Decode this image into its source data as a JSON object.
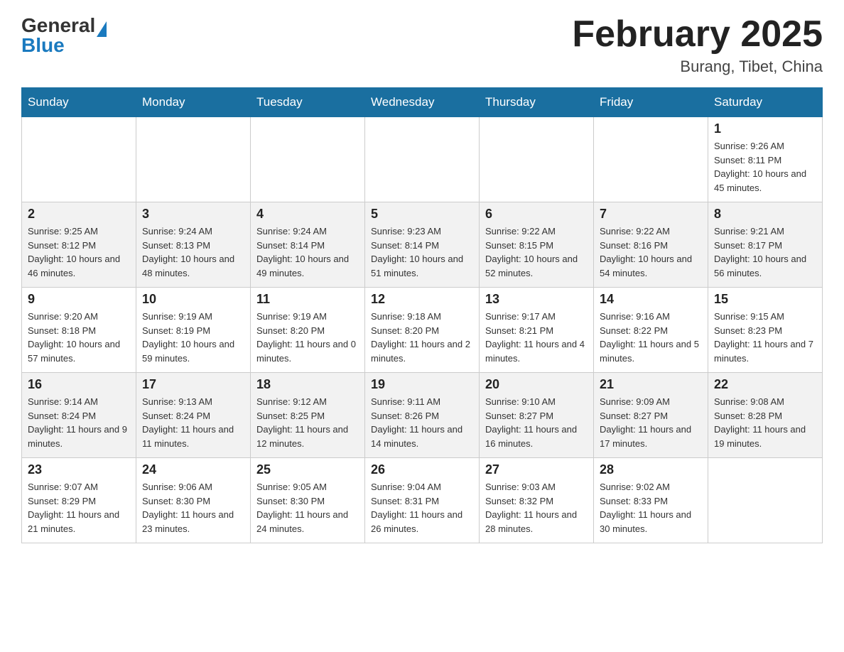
{
  "header": {
    "logo_general": "General",
    "logo_blue": "Blue",
    "month_title": "February 2025",
    "location": "Burang, Tibet, China"
  },
  "days_of_week": [
    "Sunday",
    "Monday",
    "Tuesday",
    "Wednesday",
    "Thursday",
    "Friday",
    "Saturday"
  ],
  "weeks": [
    [
      {
        "day": "",
        "sunrise": "",
        "sunset": "",
        "daylight": ""
      },
      {
        "day": "",
        "sunrise": "",
        "sunset": "",
        "daylight": ""
      },
      {
        "day": "",
        "sunrise": "",
        "sunset": "",
        "daylight": ""
      },
      {
        "day": "",
        "sunrise": "",
        "sunset": "",
        "daylight": ""
      },
      {
        "day": "",
        "sunrise": "",
        "sunset": "",
        "daylight": ""
      },
      {
        "day": "",
        "sunrise": "",
        "sunset": "",
        "daylight": ""
      },
      {
        "day": "1",
        "sunrise": "Sunrise: 9:26 AM",
        "sunset": "Sunset: 8:11 PM",
        "daylight": "Daylight: 10 hours and 45 minutes."
      }
    ],
    [
      {
        "day": "2",
        "sunrise": "Sunrise: 9:25 AM",
        "sunset": "Sunset: 8:12 PM",
        "daylight": "Daylight: 10 hours and 46 minutes."
      },
      {
        "day": "3",
        "sunrise": "Sunrise: 9:24 AM",
        "sunset": "Sunset: 8:13 PM",
        "daylight": "Daylight: 10 hours and 48 minutes."
      },
      {
        "day": "4",
        "sunrise": "Sunrise: 9:24 AM",
        "sunset": "Sunset: 8:14 PM",
        "daylight": "Daylight: 10 hours and 49 minutes."
      },
      {
        "day": "5",
        "sunrise": "Sunrise: 9:23 AM",
        "sunset": "Sunset: 8:14 PM",
        "daylight": "Daylight: 10 hours and 51 minutes."
      },
      {
        "day": "6",
        "sunrise": "Sunrise: 9:22 AM",
        "sunset": "Sunset: 8:15 PM",
        "daylight": "Daylight: 10 hours and 52 minutes."
      },
      {
        "day": "7",
        "sunrise": "Sunrise: 9:22 AM",
        "sunset": "Sunset: 8:16 PM",
        "daylight": "Daylight: 10 hours and 54 minutes."
      },
      {
        "day": "8",
        "sunrise": "Sunrise: 9:21 AM",
        "sunset": "Sunset: 8:17 PM",
        "daylight": "Daylight: 10 hours and 56 minutes."
      }
    ],
    [
      {
        "day": "9",
        "sunrise": "Sunrise: 9:20 AM",
        "sunset": "Sunset: 8:18 PM",
        "daylight": "Daylight: 10 hours and 57 minutes."
      },
      {
        "day": "10",
        "sunrise": "Sunrise: 9:19 AM",
        "sunset": "Sunset: 8:19 PM",
        "daylight": "Daylight: 10 hours and 59 minutes."
      },
      {
        "day": "11",
        "sunrise": "Sunrise: 9:19 AM",
        "sunset": "Sunset: 8:20 PM",
        "daylight": "Daylight: 11 hours and 0 minutes."
      },
      {
        "day": "12",
        "sunrise": "Sunrise: 9:18 AM",
        "sunset": "Sunset: 8:20 PM",
        "daylight": "Daylight: 11 hours and 2 minutes."
      },
      {
        "day": "13",
        "sunrise": "Sunrise: 9:17 AM",
        "sunset": "Sunset: 8:21 PM",
        "daylight": "Daylight: 11 hours and 4 minutes."
      },
      {
        "day": "14",
        "sunrise": "Sunrise: 9:16 AM",
        "sunset": "Sunset: 8:22 PM",
        "daylight": "Daylight: 11 hours and 5 minutes."
      },
      {
        "day": "15",
        "sunrise": "Sunrise: 9:15 AM",
        "sunset": "Sunset: 8:23 PM",
        "daylight": "Daylight: 11 hours and 7 minutes."
      }
    ],
    [
      {
        "day": "16",
        "sunrise": "Sunrise: 9:14 AM",
        "sunset": "Sunset: 8:24 PM",
        "daylight": "Daylight: 11 hours and 9 minutes."
      },
      {
        "day": "17",
        "sunrise": "Sunrise: 9:13 AM",
        "sunset": "Sunset: 8:24 PM",
        "daylight": "Daylight: 11 hours and 11 minutes."
      },
      {
        "day": "18",
        "sunrise": "Sunrise: 9:12 AM",
        "sunset": "Sunset: 8:25 PM",
        "daylight": "Daylight: 11 hours and 12 minutes."
      },
      {
        "day": "19",
        "sunrise": "Sunrise: 9:11 AM",
        "sunset": "Sunset: 8:26 PM",
        "daylight": "Daylight: 11 hours and 14 minutes."
      },
      {
        "day": "20",
        "sunrise": "Sunrise: 9:10 AM",
        "sunset": "Sunset: 8:27 PM",
        "daylight": "Daylight: 11 hours and 16 minutes."
      },
      {
        "day": "21",
        "sunrise": "Sunrise: 9:09 AM",
        "sunset": "Sunset: 8:27 PM",
        "daylight": "Daylight: 11 hours and 17 minutes."
      },
      {
        "day": "22",
        "sunrise": "Sunrise: 9:08 AM",
        "sunset": "Sunset: 8:28 PM",
        "daylight": "Daylight: 11 hours and 19 minutes."
      }
    ],
    [
      {
        "day": "23",
        "sunrise": "Sunrise: 9:07 AM",
        "sunset": "Sunset: 8:29 PM",
        "daylight": "Daylight: 11 hours and 21 minutes."
      },
      {
        "day": "24",
        "sunrise": "Sunrise: 9:06 AM",
        "sunset": "Sunset: 8:30 PM",
        "daylight": "Daylight: 11 hours and 23 minutes."
      },
      {
        "day": "25",
        "sunrise": "Sunrise: 9:05 AM",
        "sunset": "Sunset: 8:30 PM",
        "daylight": "Daylight: 11 hours and 24 minutes."
      },
      {
        "day": "26",
        "sunrise": "Sunrise: 9:04 AM",
        "sunset": "Sunset: 8:31 PM",
        "daylight": "Daylight: 11 hours and 26 minutes."
      },
      {
        "day": "27",
        "sunrise": "Sunrise: 9:03 AM",
        "sunset": "Sunset: 8:32 PM",
        "daylight": "Daylight: 11 hours and 28 minutes."
      },
      {
        "day": "28",
        "sunrise": "Sunrise: 9:02 AM",
        "sunset": "Sunset: 8:33 PM",
        "daylight": "Daylight: 11 hours and 30 minutes."
      },
      {
        "day": "",
        "sunrise": "",
        "sunset": "",
        "daylight": ""
      }
    ]
  ]
}
